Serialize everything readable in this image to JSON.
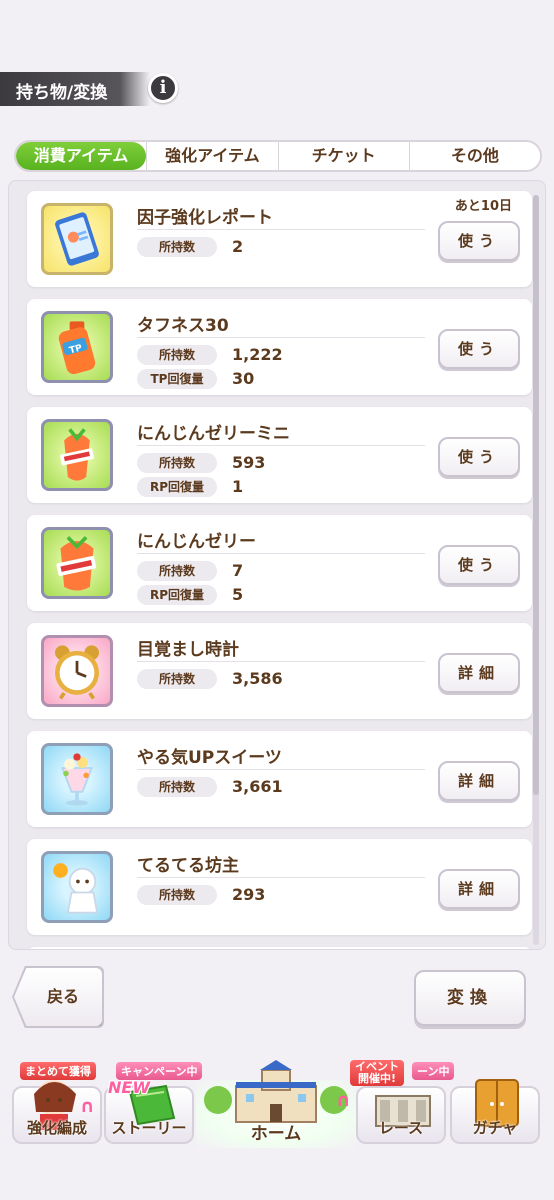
{
  "header": {
    "title": "持ち物/変換",
    "info_glyph": "i"
  },
  "tabs": [
    {
      "label": "消費アイテム",
      "active": true
    },
    {
      "label": "強化アイテム",
      "active": false
    },
    {
      "label": "チケット",
      "active": false
    },
    {
      "label": "その他",
      "active": false
    }
  ],
  "items": [
    {
      "name": "因子強化レポート",
      "icon": "tablet-report-icon",
      "limit": "あと10日",
      "stats": [
        {
          "label": "所持数",
          "value": "2"
        }
      ],
      "button": "使う"
    },
    {
      "name": "タフネス30",
      "icon": "tp-bottle-icon",
      "limit": "",
      "stats": [
        {
          "label": "所持数",
          "value": "1,222"
        },
        {
          "label": "TP回復量",
          "value": "30"
        }
      ],
      "button": "使う"
    },
    {
      "name": "にんじんゼリーミニ",
      "icon": "carrot-jelly-mini-icon",
      "limit": "",
      "stats": [
        {
          "label": "所持数",
          "value": "593"
        },
        {
          "label": "RP回復量",
          "value": "1"
        }
      ],
      "button": "使う"
    },
    {
      "name": "にんじんゼリー",
      "icon": "carrot-jelly-icon",
      "limit": "",
      "stats": [
        {
          "label": "所持数",
          "value": "7"
        },
        {
          "label": "RP回復量",
          "value": "5"
        }
      ],
      "button": "使う"
    },
    {
      "name": "目覚まし時計",
      "icon": "alarm-clock-icon",
      "limit": "",
      "stats": [
        {
          "label": "所持数",
          "value": "3,586"
        }
      ],
      "button": "詳細"
    },
    {
      "name": "やる気UPスイーツ",
      "icon": "parfait-icon",
      "limit": "",
      "stats": [
        {
          "label": "所持数",
          "value": "3,661"
        }
      ],
      "button": "詳細"
    },
    {
      "name": "てるてる坊主",
      "icon": "teru-teru-bozu-icon",
      "limit": "",
      "stats": [
        {
          "label": "所持数",
          "value": "293"
        }
      ],
      "button": "詳細"
    }
  ],
  "footer": {
    "back_label": "戻る",
    "convert_label": "変換"
  },
  "nav": {
    "training": {
      "label": "強化編成",
      "badge": "まとめて獲得"
    },
    "story": {
      "label": "ストーリー",
      "badge": "キャンペーン中",
      "new": "NEW"
    },
    "home": {
      "label": "ホーム"
    },
    "race": {
      "label": "レース",
      "badge_line1": "イベント",
      "badge_line2": "開催中!",
      "badge2": "ーン中"
    },
    "gacha": {
      "label": "ガチャ"
    }
  },
  "colors": {
    "accent_green": "#6cc22b",
    "text_brown": "#5b3a1e",
    "background": "#f3f0f5"
  }
}
